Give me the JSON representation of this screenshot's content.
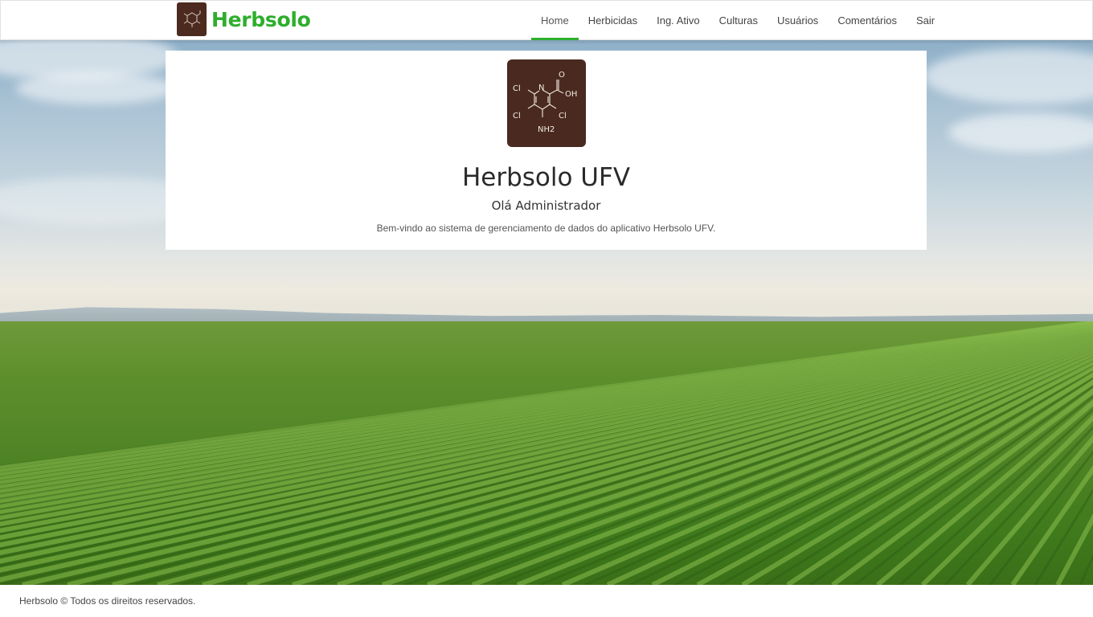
{
  "brand": {
    "name": "Herbsolo",
    "logo_icon": "picloram-molecule-icon",
    "accent_color": "#2eae2c",
    "logo_bg": "#4c2a1f"
  },
  "nav": {
    "items": [
      {
        "label": "Home",
        "active": true
      },
      {
        "label": "Herbicidas"
      },
      {
        "label": "Ing. Ativo"
      },
      {
        "label": "Culturas"
      },
      {
        "label": "Usuários"
      },
      {
        "label": "Comentários"
      },
      {
        "label": "Sair"
      }
    ]
  },
  "welcome": {
    "logo_icon": "picloram-molecule-icon",
    "molecule_labels": {
      "o": "O",
      "oh": "OH",
      "n": "N",
      "cl1": "Cl",
      "cl2": "Cl",
      "cl3": "Cl",
      "nh2": "NH2"
    },
    "title": "Herbsolo UFV",
    "greeting": "Olá Administrador",
    "description": "Bem-vindo ao sistema de gerenciamento de dados do aplicativo Herbsolo UFV."
  },
  "footer": {
    "text": "Herbsolo © Todos os direitos reservados."
  }
}
